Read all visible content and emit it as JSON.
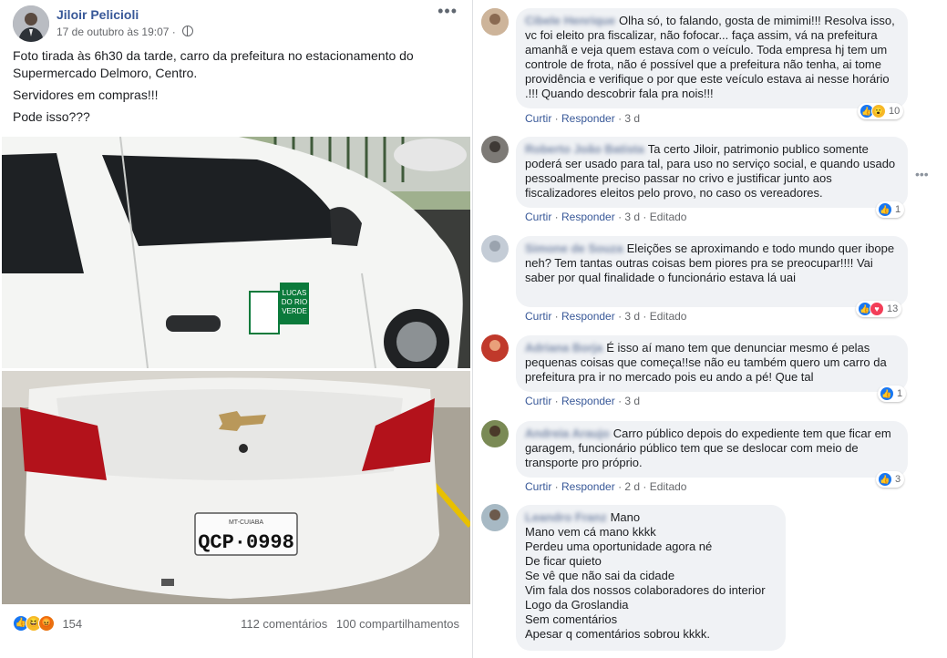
{
  "post": {
    "author": "Jiloir Pelicioli",
    "timestamp": "17 de outubro às 19:07",
    "more_label": "•••",
    "paragraphs": [
      "Foto tirada às 6h30 da tarde, carro da prefeitura no estacionamento do Supermercado Delmoro, Centro.",
      "Servidores em compras!!!",
      "Pode isso???"
    ],
    "photo1": {
      "sticker_text_line1": "LUCAS",
      "sticker_text_line2": "DO RIO",
      "sticker_text_line3": "VERDE"
    },
    "photo2": {
      "plate": "QCP·0998",
      "plate_top": "MT-CUIABA"
    },
    "reactions": {
      "icons": [
        "like-icon",
        "haha-icon",
        "angry-icon"
      ],
      "count": "154"
    },
    "comments_count": "112 comentários",
    "shares_count": "100 compartilhamentos"
  },
  "comments": [
    {
      "name": "Cibele Henrique",
      "text": "Olha só, to falando, gosta de mimimi!!! Resolva isso, vc foi eleito pra fiscalizar, não fofocar... faça assim, vá na prefeitura amanhã e veja quem estava com o veículo. Toda empresa hj tem um controle de frota, não é possível que a prefeitura não tenha, ai tome providência e verifique o por que este veículo estava ai nesse horário .!!! Quando descobrir fala pra nois!!!",
      "like": "Curtir",
      "reply": "Responder",
      "time": "3 d",
      "edited": "",
      "reaction_count": "10"
    },
    {
      "name": "Roberto João Batista",
      "text": "Ta certo Jiloir, patrimonio publico somente poderá ser usado para tal, para uso no serviço social, e quando usado pessoalmente preciso passar no crivo e justificar junto aos fiscalizadores eleitos pelo provo, no caso os vereadores.",
      "like": "Curtir",
      "reply": "Responder",
      "time": "3 d",
      "edited": "Editado",
      "reaction_count": "1"
    },
    {
      "name": "Simone de Souza",
      "text": "Eleições se aproximando e todo mundo quer ibope neh? Tem tantas outras coisas bem piores pra se preocupar!!!! Vai saber por qual finalidade o funcionário estava lá uai",
      "like": "Curtir",
      "reply": "Responder",
      "time": "3 d",
      "edited": "Editado",
      "reaction_count": "13"
    },
    {
      "name": "Adriana Borja",
      "text": "É isso aí mano tem que denunciar mesmo é pelas pequenas coisas que começa!!se não eu também quero um carro da prefeitura pra ir no mercado pois eu ando a pé! Que tal",
      "like": "Curtir",
      "reply": "Responder",
      "time": "3 d",
      "edited": "",
      "reaction_count": "1"
    },
    {
      "name": "Andreia Araujo",
      "text": "Carro público depois do expediente tem que ficar em garagem, funcionário público tem que se deslocar com meio de transporte pro próprio.",
      "like": "Curtir",
      "reply": "Responder",
      "time": "2 d",
      "edited": "Editado",
      "reaction_count": "3"
    },
    {
      "name": "Leandro Franz",
      "lines": [
        "Mano",
        "Mano vem cá mano kkkk",
        "Perdeu uma oportunidade agora né",
        "De ficar quieto",
        "Se vê que não sai da cidade",
        "Vim fala dos nossos colaboradores do interior",
        "Logo da Groslandia",
        "Sem comentários",
        "Apesar q comentários sobrou kkkk."
      ]
    }
  ],
  "comment_menu_label": "•••",
  "colors": {
    "link": "#385898",
    "like": "#1877f2",
    "bubble": "#f0f2f5"
  }
}
